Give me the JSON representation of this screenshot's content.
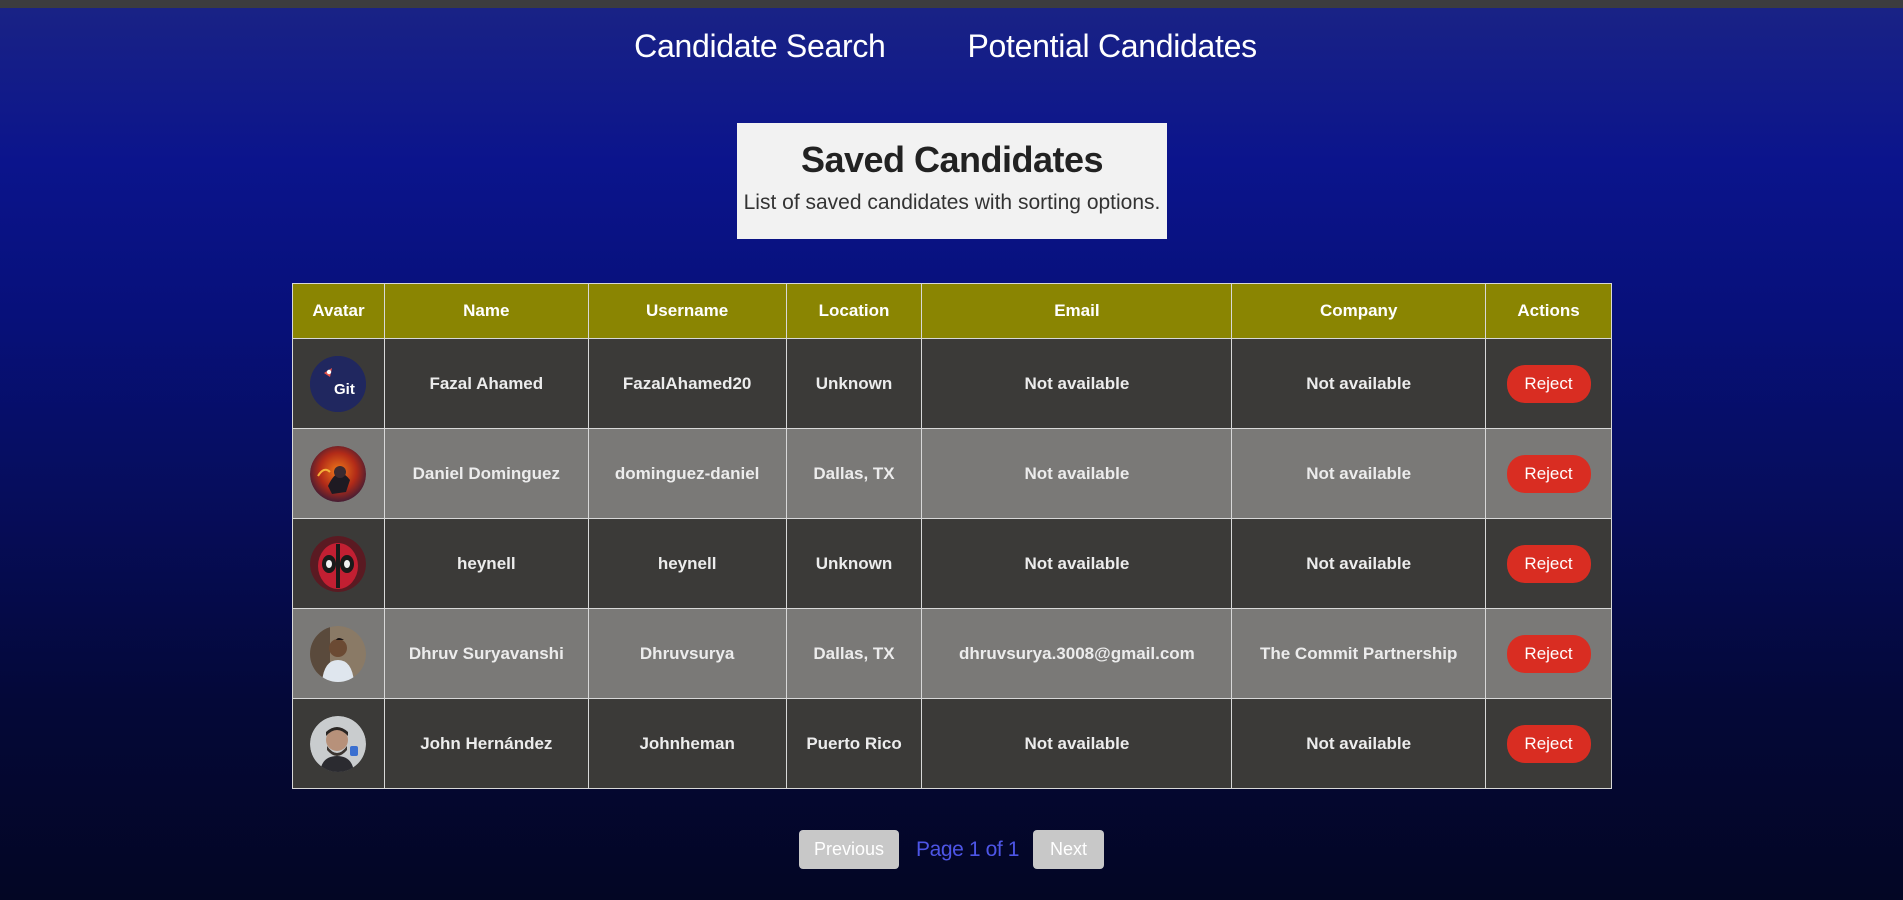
{
  "nav": {
    "search_label": "Candidate Search",
    "potential_label": "Potential Candidates"
  },
  "header": {
    "title": "Saved Candidates",
    "subtitle": "List of saved candidates with sorting options."
  },
  "table": {
    "columns": [
      "Avatar",
      "Name",
      "Username",
      "Location",
      "Email",
      "Company",
      "Actions"
    ],
    "rows": [
      {
        "avatar": "git-logo-avatar",
        "name": "Fazal Ahamed",
        "username": "FazalAhamed20",
        "location": "Unknown",
        "email": "Not available",
        "company": "Not available",
        "action": "Reject"
      },
      {
        "avatar": "illustrated-avatar",
        "name": "Daniel Dominguez",
        "username": "dominguez-daniel",
        "location": "Dallas, TX",
        "email": "Not available",
        "company": "Not available",
        "action": "Reject"
      },
      {
        "avatar": "deadpool-avatar",
        "name": "heynell",
        "username": "heynell",
        "location": "Unknown",
        "email": "Not available",
        "company": "Not available",
        "action": "Reject"
      },
      {
        "avatar": "photo-avatar",
        "name": "Dhruv Suryavanshi",
        "username": "Dhruvsurya",
        "location": "Dallas, TX",
        "email": "dhruvsurya.3008@gmail.com",
        "company": "The Commit Partnership",
        "action": "Reject"
      },
      {
        "avatar": "photo-avatar",
        "name": "John Hernández",
        "username": "Johnheman",
        "location": "Puerto Rico",
        "email": "Not available",
        "company": "Not available",
        "action": "Reject"
      }
    ]
  },
  "avatar_logo_text": "Git",
  "pagination": {
    "prev_label": "Previous",
    "page_info": "Page 1 of 1",
    "next_label": "Next"
  },
  "colors": {
    "header_bg": "#8a8502",
    "reject": "#d92d22",
    "page_info": "#4d55e6"
  }
}
